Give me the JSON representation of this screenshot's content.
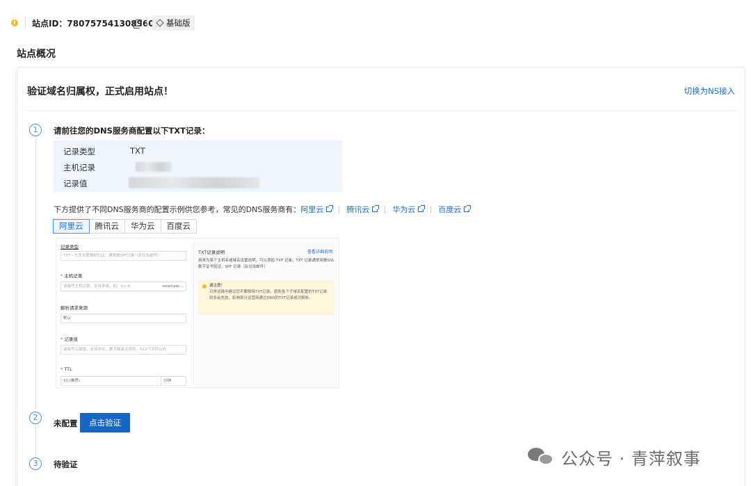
{
  "topbar": {
    "site_id_label": "站点ID：780757541308960",
    "plan_label": "基础版"
  },
  "overview_title": "站点概况",
  "card": {
    "title": "验证域名归属权，正式启用站点！",
    "switch_ns_link": "切换为NS接入"
  },
  "steps": [
    {
      "number": "1",
      "label": "请前往您的DNS服务商配置以下TXT记录："
    },
    {
      "number": "2",
      "label": "未配置"
    },
    {
      "number": "3",
      "label": "待验证"
    }
  ],
  "record": {
    "type_label": "记录类型",
    "type_value": "TXT",
    "host_label": "主机记录",
    "value_label": "记录值"
  },
  "providers": {
    "intro": "下方提供了不同DNS服务商的配置示例供您参考，常见的DNS服务商有：",
    "links": [
      "阿里云",
      "腾讯云",
      "华为云",
      "百度云"
    ]
  },
  "tabs": [
    "阿里云",
    "腾讯云",
    "华为云",
    "百度云"
  ],
  "example": {
    "record_type_label": "记录类型",
    "record_type_value": "TXT - 文本长度限制512，通常做SPF记录（反垃圾邮件）",
    "host_label": "主机记录",
    "host_placeholder": "请填写主机记录，支持多级，如：d.c.b",
    "host_suffix": ".example...",
    "line_label": "解析请求来源",
    "line_value": "默认",
    "value_label": "记录值",
    "value_placeholder": "请填写记录值，支持中文、数字和英文符号，512个字符以内",
    "ttl_label": "TTL",
    "ttl_value": "10 (推荐)",
    "ttl_unit": "分钟",
    "help_title": "TXT记录说明",
    "help_link": "查看详细说明",
    "help_text": "用来为某个主机名或域名设置说明，可以添加 TXT 记录。TXT 记录通常用做SSL数字证书验证、SPF 记录（反垃圾邮件）",
    "tip_title": "请注意！",
    "tip_text": "日常运维中建议您不要删除TXT记录，避免各个子域名配置的TXT记录较多会失效，影响部分运营商通过DNS的TXT记录成功解析。"
  },
  "verify_button": "点击验证",
  "watermark": "公众号 · 青萍叙事",
  "colors": {
    "accent": "#1667c5",
    "link": "#1a6fcc",
    "warning": "#f5b921",
    "record_bg": "#eef5fc"
  }
}
